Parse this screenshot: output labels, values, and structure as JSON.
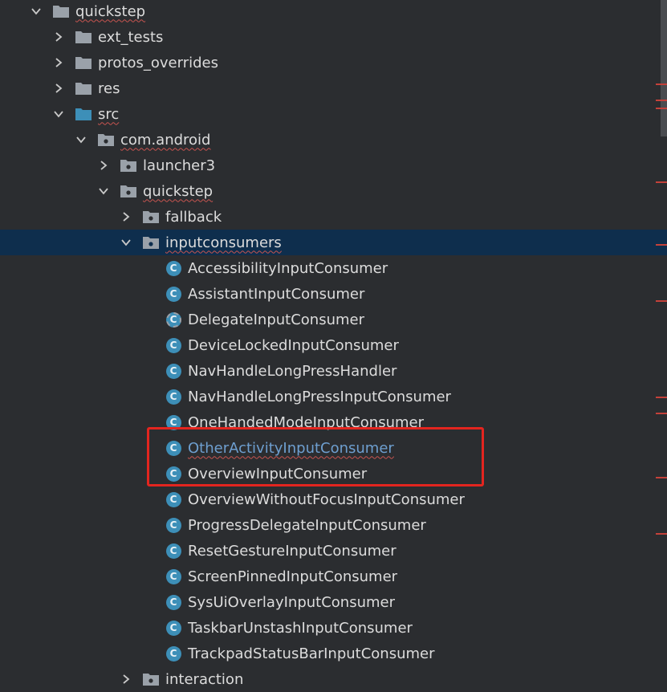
{
  "tree": {
    "root": {
      "label": "quickstep"
    },
    "items": [
      {
        "label": "ext_tests"
      },
      {
        "label": "protos_overrides"
      },
      {
        "label": "res"
      },
      {
        "label": "src"
      },
      {
        "label": "com.android"
      },
      {
        "label": "launcher3"
      },
      {
        "label": "quickstep"
      },
      {
        "label": "fallback"
      },
      {
        "label": "inputconsumers"
      },
      {
        "label": "AccessibilityInputConsumer"
      },
      {
        "label": "AssistantInputConsumer"
      },
      {
        "label": "DelegateInputConsumer"
      },
      {
        "label": "DeviceLockedInputConsumer"
      },
      {
        "label": "NavHandleLongPressHandler"
      },
      {
        "label": "NavHandleLongPressInputConsumer"
      },
      {
        "label": "OneHandedModeInputConsumer"
      },
      {
        "label": "OtherActivityInputConsumer"
      },
      {
        "label": "OverviewInputConsumer"
      },
      {
        "label": "OverviewWithoutFocusInputConsumer"
      },
      {
        "label": "ProgressDelegateInputConsumer"
      },
      {
        "label": "ResetGestureInputConsumer"
      },
      {
        "label": "ScreenPinnedInputConsumer"
      },
      {
        "label": "SysUiOverlayInputConsumer"
      },
      {
        "label": "TaskbarUnstashInputConsumer"
      },
      {
        "label": "TrackpadStatusBarInputConsumer"
      },
      {
        "label": "interaction"
      }
    ],
    "class_icon_letter": "C"
  },
  "colors": {
    "background": "#2b2d30",
    "selection": "#0e2e4d",
    "class_icon": "#3d8fb8",
    "highlight_box": "#e3251f",
    "error_stripe": "#c4413a"
  }
}
